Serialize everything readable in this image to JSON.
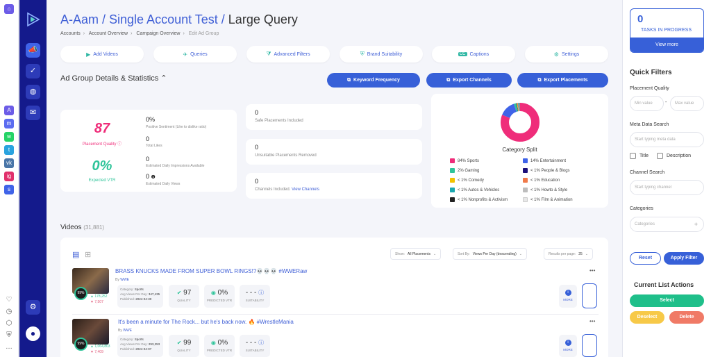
{
  "strip_apps": [
    {
      "icon": "assistant-app-icon",
      "glyph": "A",
      "color": "#6c5ce7"
    },
    {
      "icon": "messenger-icon",
      "glyph": "m",
      "color": "#5b6cf0"
    },
    {
      "icon": "whatsapp-icon",
      "glyph": "w",
      "color": "#25d366"
    },
    {
      "icon": "telegram-icon",
      "glyph": "t",
      "color": "#2aa3df"
    },
    {
      "icon": "vk-icon",
      "glyph": "vk",
      "color": "#4a76a8"
    },
    {
      "icon": "instagram-icon",
      "glyph": "ig",
      "color": "#e1306c"
    },
    {
      "icon": "store-icon",
      "glyph": "s",
      "color": "#3f63e8"
    }
  ],
  "strip_bottom": [
    {
      "icon": "heart-icon",
      "glyph": "♡"
    },
    {
      "icon": "clock-icon",
      "glyph": "◷"
    },
    {
      "icon": "cube-icon",
      "glyph": "⬡"
    },
    {
      "icon": "shield-app-icon",
      "glyph": "⛨"
    },
    {
      "icon": "more-icon",
      "glyph": "…"
    }
  ],
  "header": {
    "title_prefix": "A-Aam / Single Account Test / ",
    "title_current": "Large Query",
    "breadcrumbs": [
      "Accounts",
      "Account Overview",
      "Campaign Overview",
      "Edit Ad Group"
    ]
  },
  "tabs": [
    {
      "label": "Add Videos",
      "icon": "▶"
    },
    {
      "label": "Queries",
      "icon": "✈"
    },
    {
      "label": "Advanced Filters",
      "icon": "⧩"
    },
    {
      "label": "Brand Suitability",
      "icon": "⛨"
    },
    {
      "label": "Captions",
      "icon": "CC"
    },
    {
      "label": "Settings",
      "icon": "⚙"
    }
  ],
  "section": {
    "title": "Ad Group Details & Statistics",
    "buttons": [
      "Keyword Frequency",
      "Export Channels",
      "Export Placements"
    ]
  },
  "stats": {
    "placement_quality": "87",
    "placement_quality_label": "Placement Quality",
    "expected_vtr": "0%",
    "expected_vtr_label": "Expected VTR",
    "items": [
      {
        "value": "0%",
        "label": "Positive Sentiment (Like to dislike ratio)"
      },
      {
        "value": "0",
        "label": "Total Likes"
      },
      {
        "value": "0",
        "label": "Estimated Daily Impressions Available"
      },
      {
        "value": "0",
        "label": "Estimated Daily Views"
      }
    ],
    "mid": [
      {
        "value": "0",
        "label": "Safe Placements Included"
      },
      {
        "value": "0",
        "label": "Unsuitable Placements Removed"
      },
      {
        "value": "0",
        "label": "Channels Included.",
        "link": "View Channels"
      }
    ]
  },
  "chart_data": {
    "type": "pie",
    "title": "Category Split",
    "series": [
      {
        "name": "Sports",
        "value": 84,
        "label": "84% Sports",
        "color": "#ef2d7a"
      },
      {
        "name": "Entertainment",
        "value": 14,
        "label": "14% Entertainment",
        "color": "#3f63e8"
      },
      {
        "name": "Gaming",
        "value": 2,
        "label": "2% Gaming",
        "color": "#2fc49a"
      },
      {
        "name": "People & Blogs",
        "value": 0.5,
        "label": "< 1% People & Blogs",
        "color": "#1b0f7a"
      },
      {
        "name": "Comedy",
        "value": 0.5,
        "label": "< 1% Comedy",
        "color": "#f2c200"
      },
      {
        "name": "Education",
        "value": 0.5,
        "label": "< 1% Education",
        "color": "#f07a4a"
      },
      {
        "name": "Autos & Vehicles",
        "value": 0.5,
        "label": "< 1% Autos & Vehicles",
        "color": "#1aa8b0"
      },
      {
        "name": "Howto & Style",
        "value": 0.5,
        "label": "< 1% Howto & Style",
        "color": "#bdbdbd"
      },
      {
        "name": "Nonprofits & Activism",
        "value": 0.5,
        "label": "< 1% Nonprofits & Activism",
        "color": "#222222"
      },
      {
        "name": "Film & Animation",
        "value": 0.5,
        "label": "< 1% Film & Animation",
        "color": "#e8e8e8"
      }
    ]
  },
  "videos": {
    "title": "Videos",
    "count": "(31,881)",
    "show_label": "Show:",
    "show_value": "All Placements",
    "sort_label": "Sort By:",
    "sort_value": "Views Per Day (descending)",
    "results_label": "Results per page:",
    "results_value": "25",
    "rows": [
      {
        "title": "BRASS KNUCKS MADE FROM SUPER BOWL RINGS!?💀💀💀 #WWERaw",
        "by": "By",
        "channel": "WWE",
        "score": "99%",
        "likes": "178,252",
        "dislikes": "7,507",
        "category_label": "Category:",
        "category": "Sports",
        "avg_label": "Avg Views Per Day:",
        "avg": "347,435",
        "published_label": "Published:",
        "published": "2024-04-30",
        "quality": "97",
        "quality_label": "QUALITY",
        "vtr": "0%",
        "vtr_label": "PREDICTED VTR",
        "suitability": "- - -",
        "suitability_label": "SUITABILITY",
        "more_label": "MORE"
      },
      {
        "title": "It's been a minute for The Rock... but he's back now. 🔥 #WrestleMania",
        "by": "By",
        "channel": "WWE",
        "score": "99%",
        "likes": "1,064,803",
        "dislikes": "7,409",
        "category_label": "Category:",
        "category": "Sports",
        "avg_label": "Avg Views Per Day:",
        "avg": "293,253",
        "published_label": "Published:",
        "published": "2024-04-07",
        "quality": "99",
        "quality_label": "QUALITY",
        "vtr": "0%",
        "vtr_label": "PREDICTED VTR",
        "suitability": "- - -",
        "suitability_label": "SUITABILITY",
        "more_label": "MORE"
      }
    ]
  },
  "tasks": {
    "count": "0",
    "label": "TASKS IN PROGRESS",
    "button": "View more"
  },
  "filters": {
    "title": "Quick Filters",
    "placement_quality": "Placement Quality",
    "min_placeholder": "Min value",
    "max_placeholder": "Max value",
    "range_sep": "-",
    "meta_search": "Meta Data Search",
    "meta_placeholder": "Start typing meta data",
    "title_cb": "Title",
    "description_cb": "Description",
    "channel_search": "Channel Search",
    "channel_placeholder": "Start typing channel",
    "categories": "Categories",
    "categories_placeholder": "Categories",
    "reset": "Reset",
    "apply": "Apply Filter"
  },
  "list_actions": {
    "title": "Current List Actions",
    "select": "Select",
    "deselect": "Deselect",
    "delete": "Delete"
  }
}
